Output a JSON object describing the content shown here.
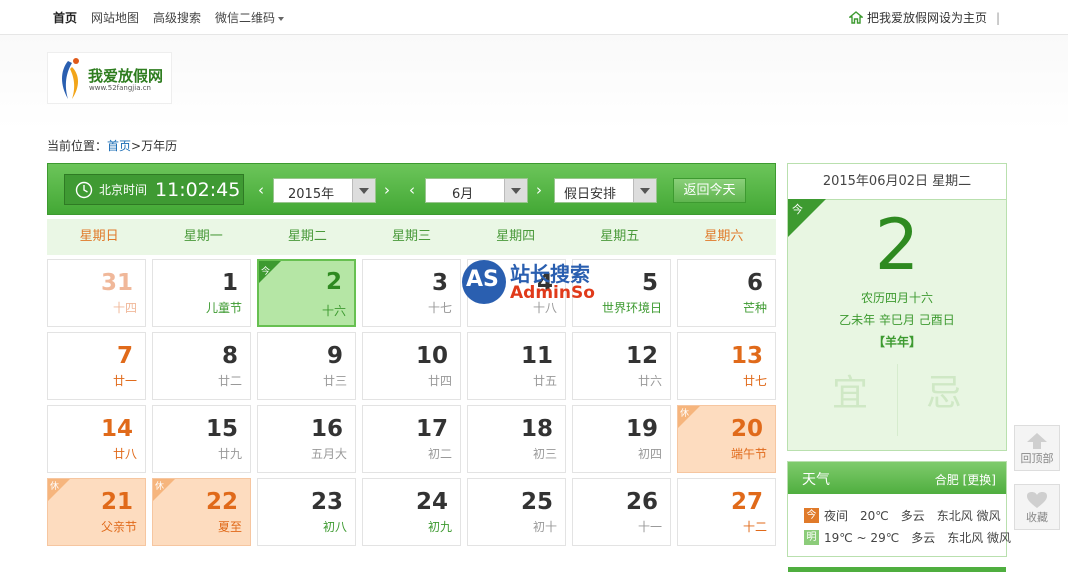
{
  "topnav": {
    "items": [
      "首页",
      "网站地图",
      "高级搜索",
      "微信二维码"
    ],
    "set_home": "把我爱放假网设为主页",
    "sep": "|"
  },
  "logo": {
    "brand": "我爱放假网",
    "url": "www.52fangjia.cn"
  },
  "breadcrumb": {
    "prefix": "当前位置：",
    "home": "首页",
    "sep": ">",
    "current": "万年历"
  },
  "toolbar": {
    "clock_label": "北京时间",
    "time": "11:02:45",
    "year": "2015年",
    "month": "6月",
    "holiday": "假日安排",
    "today_button": "返回今天",
    "prev": "‹",
    "next": "›"
  },
  "weekdays": [
    "星期日",
    "星期一",
    "星期二",
    "星期三",
    "星期四",
    "星期五",
    "星期六"
  ],
  "weeks": [
    [
      {
        "d": "31",
        "l": "十四",
        "t": "other"
      },
      {
        "d": "1",
        "l": "儿童节",
        "t": "festg"
      },
      {
        "d": "2",
        "l": "十六",
        "t": "today",
        "tag": "今"
      },
      {
        "d": "3",
        "l": "十七"
      },
      {
        "d": "4",
        "l": "十八"
      },
      {
        "d": "5",
        "l": "世界环境日",
        "t": "festg"
      },
      {
        "d": "6",
        "l": "芒种",
        "t": "festg"
      }
    ],
    [
      {
        "d": "7",
        "l": "廿一"
      },
      {
        "d": "8",
        "l": "廿二"
      },
      {
        "d": "9",
        "l": "廿三"
      },
      {
        "d": "10",
        "l": "廿四"
      },
      {
        "d": "11",
        "l": "廿五"
      },
      {
        "d": "12",
        "l": "廿六"
      },
      {
        "d": "13",
        "l": "廿七"
      }
    ],
    [
      {
        "d": "14",
        "l": "廿八"
      },
      {
        "d": "15",
        "l": "廿九"
      },
      {
        "d": "16",
        "l": "五月大"
      },
      {
        "d": "17",
        "l": "初二"
      },
      {
        "d": "18",
        "l": "初三"
      },
      {
        "d": "19",
        "l": "初四"
      },
      {
        "d": "20",
        "l": "端午节",
        "t": "hol",
        "tag": "休"
      }
    ],
    [
      {
        "d": "21",
        "l": "父亲节",
        "t": "hol",
        "tag": "休"
      },
      {
        "d": "22",
        "l": "夏至",
        "t": "hol",
        "tag": "休"
      },
      {
        "d": "23",
        "l": "初八",
        "t": "festg"
      },
      {
        "d": "24",
        "l": "初九",
        "t": "festg"
      },
      {
        "d": "25",
        "l": "初十"
      },
      {
        "d": "26",
        "l": "十一"
      },
      {
        "d": "27",
        "l": "十二"
      }
    ]
  ],
  "side": {
    "date": "2015年06月02日 星期二",
    "today_tag": "今",
    "day": "2",
    "lunar": "农历四月十六",
    "ganzhi": "乙未年 辛巳月 己酉日",
    "zodiac": "【羊年】",
    "yi": "宜",
    "ji": "忌"
  },
  "weather": {
    "title": "天气",
    "city": "合肥",
    "change": "[更换]",
    "rows": [
      {
        "tag": "今",
        "period": "夜间",
        "temp": "20℃",
        "sky": "多云",
        "wind": "东北风 微风"
      },
      {
        "tag": "明",
        "period": "",
        "temp": "19℃ ~ 29℃",
        "sky": "多云",
        "wind": "东北风 微风"
      }
    ]
  },
  "floats": {
    "top": "回顶部",
    "fav": "收藏"
  },
  "watermark": {
    "a": "AS",
    "b": "站长搜索",
    "c": "AdminSo"
  },
  "colors": {
    "accent": "#4fae3f",
    "weekend": "#e06a1a",
    "holiday_bg": "#fddcbf",
    "today_bg": "#b5e6a5"
  }
}
